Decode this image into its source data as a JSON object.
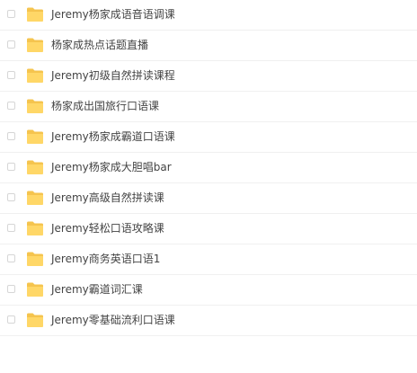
{
  "files": [
    {
      "name": "Jeremy杨家成语音语调课",
      "icon": "folder-icon"
    },
    {
      "name": "杨家成热点话题直播",
      "icon": "folder-icon"
    },
    {
      "name": "Jeremy初级自然拼读课程",
      "icon": "folder-icon"
    },
    {
      "name": "杨家成出国旅行口语课",
      "icon": "folder-icon"
    },
    {
      "name": "Jeremy杨家成霸道口语课",
      "icon": "folder-icon"
    },
    {
      "name": "Jeremy杨家成大胆唱bar",
      "icon": "folder-icon"
    },
    {
      "name": "Jeremy高级自然拼读课",
      "icon": "folder-icon"
    },
    {
      "name": "Jeremy轻松口语攻略课",
      "icon": "folder-icon"
    },
    {
      "name": "Jeremy商务英语口语1",
      "icon": "folder-icon"
    },
    {
      "name": "Jeremy霸道词汇课",
      "icon": "folder-icon"
    },
    {
      "name": "Jeremy零基础流利口语课",
      "icon": "folder-icon"
    }
  ],
  "colors": {
    "folder_back": "#f5c44e",
    "folder_front": "#ffd767",
    "text": "#444444",
    "divider": "#f0f0f0",
    "checkbox_border": "#d6d6d6"
  }
}
